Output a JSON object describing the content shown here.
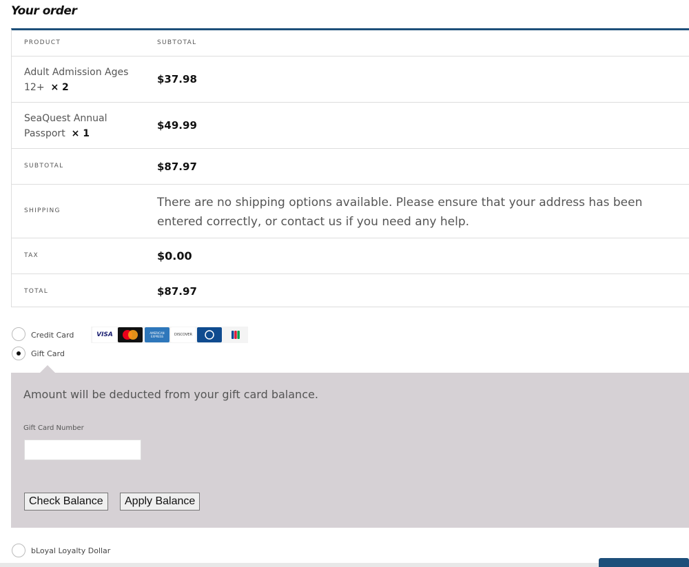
{
  "heading": "Your order",
  "table": {
    "col_product": "PRODUCT",
    "col_subtotal": "SUBTOTAL",
    "items": [
      {
        "name": "Adult Admission Ages 12+",
        "qty": "× 2",
        "price": "$37.98"
      },
      {
        "name": "SeaQuest Annual Passport",
        "qty": "× 1",
        "price": "$49.99"
      }
    ],
    "subtotal_label": "SUBTOTAL",
    "subtotal_value": "$87.97",
    "shipping_label": "SHIPPING",
    "shipping_message": "There are no shipping options available. Please ensure that your address has been entered correctly, or contact us if you need any help.",
    "tax_label": "TAX",
    "tax_value": "$0.00",
    "total_label": "TOTAL",
    "total_value": "$87.97"
  },
  "payment": {
    "credit_card_label": "Credit Card",
    "gift_card_label": "Gift Card",
    "loyalty_label": "bLoyal Loyalty Dollar",
    "selected": "Gift Card",
    "card_icons": [
      "visa-icon",
      "mastercard-icon",
      "amex-icon",
      "discover-icon",
      "diners-icon",
      "jcb-icon"
    ],
    "card_texts": {
      "visa": "VISA",
      "discover": "DISCOVER",
      "amex": "AMERICAN EXPRESS"
    }
  },
  "gift_card": {
    "message": "Amount will be deducted from your gift card balance.",
    "number_label": "Gift Card Number",
    "number_value": "",
    "check_balance": "Check Balance",
    "apply_balance": "Apply Balance"
  },
  "colors": {
    "accent": "#1d4f7a",
    "panel": "#d6d1d5"
  }
}
